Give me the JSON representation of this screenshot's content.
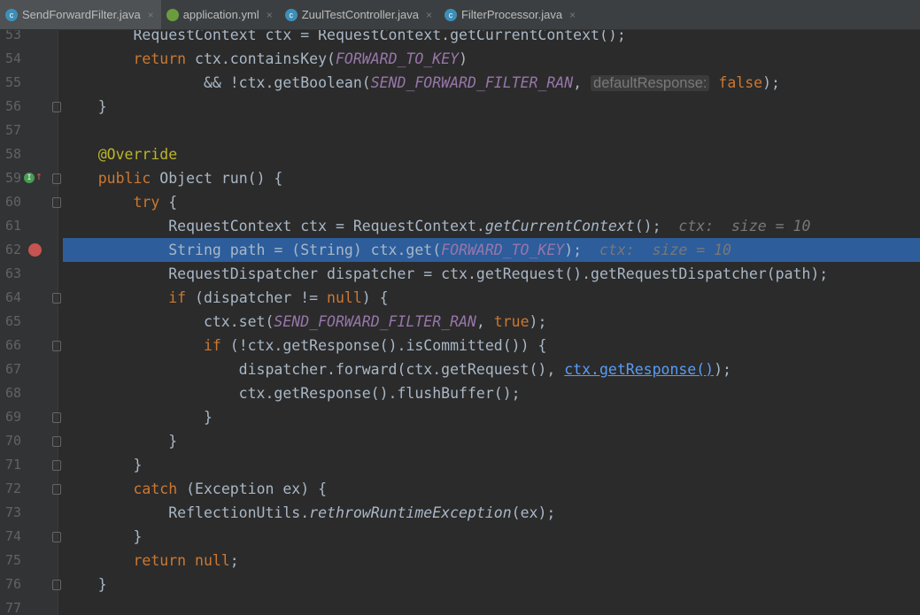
{
  "tabs": [
    {
      "label": "SendForwardFilter.java",
      "icon": "c",
      "active": true
    },
    {
      "label": "application.yml",
      "icon": "yml"
    },
    {
      "label": "ZuulTestController.java",
      "icon": "c"
    },
    {
      "label": "FilterProcessor.java",
      "icon": "c"
    }
  ],
  "close_glyph": "×",
  "lines": [
    {
      "n": "53",
      "t": [
        [
          "        RequestContext ctx = RequestContext.getCurrentContext();",
          ""
        ]
      ]
    },
    {
      "n": "54",
      "t": [
        [
          "        ",
          ""
        ],
        [
          "return ",
          "kw"
        ],
        [
          "ctx.containsKey(",
          ""
        ],
        [
          "FORWARD_TO_KEY",
          "st"
        ],
        [
          ")",
          ""
        ]
      ]
    },
    {
      "n": "55",
      "t": [
        [
          "                && !ctx.getBoolean(",
          ""
        ],
        [
          "SEND_FORWARD_FILTER_RAN",
          "st"
        ],
        [
          ", ",
          ""
        ],
        [
          "defaultResponse:",
          "hint"
        ],
        [
          " ",
          ""
        ],
        [
          "false",
          "kw"
        ],
        [
          ");",
          ""
        ]
      ]
    },
    {
      "n": "56",
      "t": [
        [
          "    }",
          ""
        ]
      ],
      "fold": true
    },
    {
      "n": "57",
      "t": []
    },
    {
      "n": "58",
      "t": [
        [
          "    ",
          ""
        ],
        [
          "@Override",
          "an"
        ]
      ]
    },
    {
      "n": "59",
      "t": [
        [
          "    ",
          ""
        ],
        [
          "public ",
          "kw"
        ],
        [
          "Object run() {",
          ""
        ]
      ],
      "fold": true,
      "override": true
    },
    {
      "n": "60",
      "t": [
        [
          "        ",
          ""
        ],
        [
          "try ",
          "kw"
        ],
        [
          "{",
          ""
        ]
      ],
      "fold": true
    },
    {
      "n": "61",
      "t": [
        [
          "            RequestContext ctx = RequestContext.",
          ""
        ],
        [
          "getCurrentContext",
          "it"
        ],
        [
          "();  ",
          ""
        ],
        [
          "ctx:  size = 10",
          "dbg"
        ]
      ]
    },
    {
      "n": "62",
      "t": [
        [
          "            String path = (String) ctx.get(",
          ""
        ],
        [
          "FORWARD_TO_KEY",
          "st"
        ],
        [
          ");  ",
          ""
        ],
        [
          "ctx:  size = 10",
          "dbg"
        ]
      ],
      "hl": true,
      "bp": true
    },
    {
      "n": "63",
      "t": [
        [
          "            RequestDispatcher dispatcher = ctx.getRequest().getRequestDispatcher(path);",
          ""
        ]
      ]
    },
    {
      "n": "64",
      "t": [
        [
          "            ",
          ""
        ],
        [
          "if ",
          "kw"
        ],
        [
          "(dispatcher != ",
          ""
        ],
        [
          "null",
          "kw"
        ],
        [
          ") {",
          ""
        ]
      ],
      "fold": true
    },
    {
      "n": "65",
      "t": [
        [
          "                ctx.set(",
          ""
        ],
        [
          "SEND_FORWARD_FILTER_RAN",
          "st"
        ],
        [
          ", ",
          ""
        ],
        [
          "true",
          "kw"
        ],
        [
          ");",
          ""
        ]
      ]
    },
    {
      "n": "66",
      "t": [
        [
          "                ",
          ""
        ],
        [
          "if ",
          "kw"
        ],
        [
          "(!ctx.getResponse().isCommitted()) {",
          ""
        ]
      ],
      "fold": true
    },
    {
      "n": "67",
      "t": [
        [
          "                    dispatcher.forward(ctx.getRequest(), ",
          ""
        ],
        [
          "ctx.getResponse()",
          "lnk"
        ],
        [
          ");",
          ""
        ]
      ]
    },
    {
      "n": "68",
      "t": [
        [
          "                    ctx.getResponse().flushBuffer();",
          ""
        ]
      ]
    },
    {
      "n": "69",
      "t": [
        [
          "                }",
          ""
        ]
      ],
      "fold": true
    },
    {
      "n": "70",
      "t": [
        [
          "            }",
          ""
        ]
      ],
      "fold": true
    },
    {
      "n": "71",
      "t": [
        [
          "        }",
          ""
        ]
      ],
      "fold": true
    },
    {
      "n": "72",
      "t": [
        [
          "        ",
          ""
        ],
        [
          "catch ",
          "kw"
        ],
        [
          "(Exception ex) {",
          ""
        ]
      ],
      "fold": true
    },
    {
      "n": "73",
      "t": [
        [
          "            ReflectionUtils.",
          ""
        ],
        [
          "rethrowRuntimeException",
          "it"
        ],
        [
          "(ex);",
          ""
        ]
      ]
    },
    {
      "n": "74",
      "t": [
        [
          "        }",
          ""
        ]
      ],
      "fold": true
    },
    {
      "n": "75",
      "t": [
        [
          "        ",
          ""
        ],
        [
          "return ",
          "kw"
        ],
        [
          "null",
          "kw"
        ],
        [
          ";",
          ""
        ]
      ]
    },
    {
      "n": "76",
      "t": [
        [
          "    }",
          ""
        ]
      ],
      "fold": true
    },
    {
      "n": "77",
      "t": []
    }
  ]
}
